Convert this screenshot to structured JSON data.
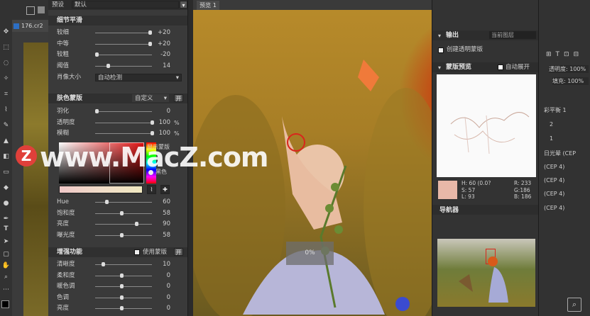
{
  "plugin": {
    "top": {
      "preset_label": "预设",
      "preset_value": "默认"
    },
    "detail": {
      "title": "细节平滑",
      "rows": [
        {
          "label": "较细",
          "value": "+20",
          "frac": 0.96
        },
        {
          "label": "中等",
          "value": "+20",
          "frac": 0.96
        },
        {
          "label": "较粗",
          "value": "-20",
          "frac": 0.0
        },
        {
          "label": "阈值",
          "value": "14",
          "frac": 0.2
        }
      ],
      "size_label": "肖像大小",
      "size_value": "自动检测"
    },
    "skin": {
      "title": "肤色蒙版",
      "mode": "自定义",
      "toggle": "开",
      "rows": [
        {
          "label": "羽化",
          "value": "0",
          "unit": "",
          "frac": 0.0
        },
        {
          "label": "透明度",
          "value": "100",
          "unit": "%",
          "frac": 1.0
        },
        {
          "label": "模糊",
          "value": "100",
          "unit": "%",
          "frac": 1.0
        }
      ],
      "show_mask_label": "显示蒙版",
      "bg_black": "黑色",
      "hue_rows": [
        {
          "label": "Hue",
          "value": "60",
          "frac": 0.18
        },
        {
          "label": "饱和度",
          "value": "58",
          "frac": 0.45
        },
        {
          "label": "亮度",
          "value": "90",
          "frac": 0.72
        },
        {
          "label": "曝光度",
          "value": "58",
          "frac": 0.45
        }
      ]
    },
    "enhance": {
      "title": "增强功能",
      "use_mask": "使用蒙版",
      "toggle": "开",
      "rows": [
        {
          "label": "清晰度",
          "value": "10",
          "frac": 0.12
        },
        {
          "label": "柔和度",
          "value": "0",
          "frac": 0.45
        },
        {
          "label": "暖色调",
          "value": "0",
          "frac": 0.45
        },
        {
          "label": "色调",
          "value": "0",
          "frac": 0.45
        },
        {
          "label": "亮度",
          "value": "0",
          "frac": 0.45
        }
      ]
    }
  },
  "preview": {
    "tab": "预览 1",
    "progress": "0%"
  },
  "right": {
    "output_title": "输出",
    "output_value": "当前图层",
    "new_mask": "创建透明蒙版",
    "mask_preview_title": "蒙版预览",
    "auto_expand": "自动展开",
    "color_info": {
      "h": "H: 60 (0.0?",
      "s": "S: 57",
      "l": "L: 93",
      "r": "R: 233",
      "g": "G:186",
      "b": "B: 186"
    },
    "navigator_title": "导航器"
  },
  "ps": {
    "doc_tab": "176.cr2",
    "right_lines": [
      "透明度: 100%",
      "填充: 100%",
      "彩平衡 1",
      "2",
      "1",
      "日光晕 (CEP",
      "(CEP 4)",
      "(CEP 4)",
      "(CEP 4)",
      "(CEP 4)"
    ]
  },
  "watermark": {
    "logo": "Z",
    "text": "www.MacZ.com"
  },
  "colors": {
    "accent_red": "#d9261c",
    "panel": "#3a3a3a"
  }
}
